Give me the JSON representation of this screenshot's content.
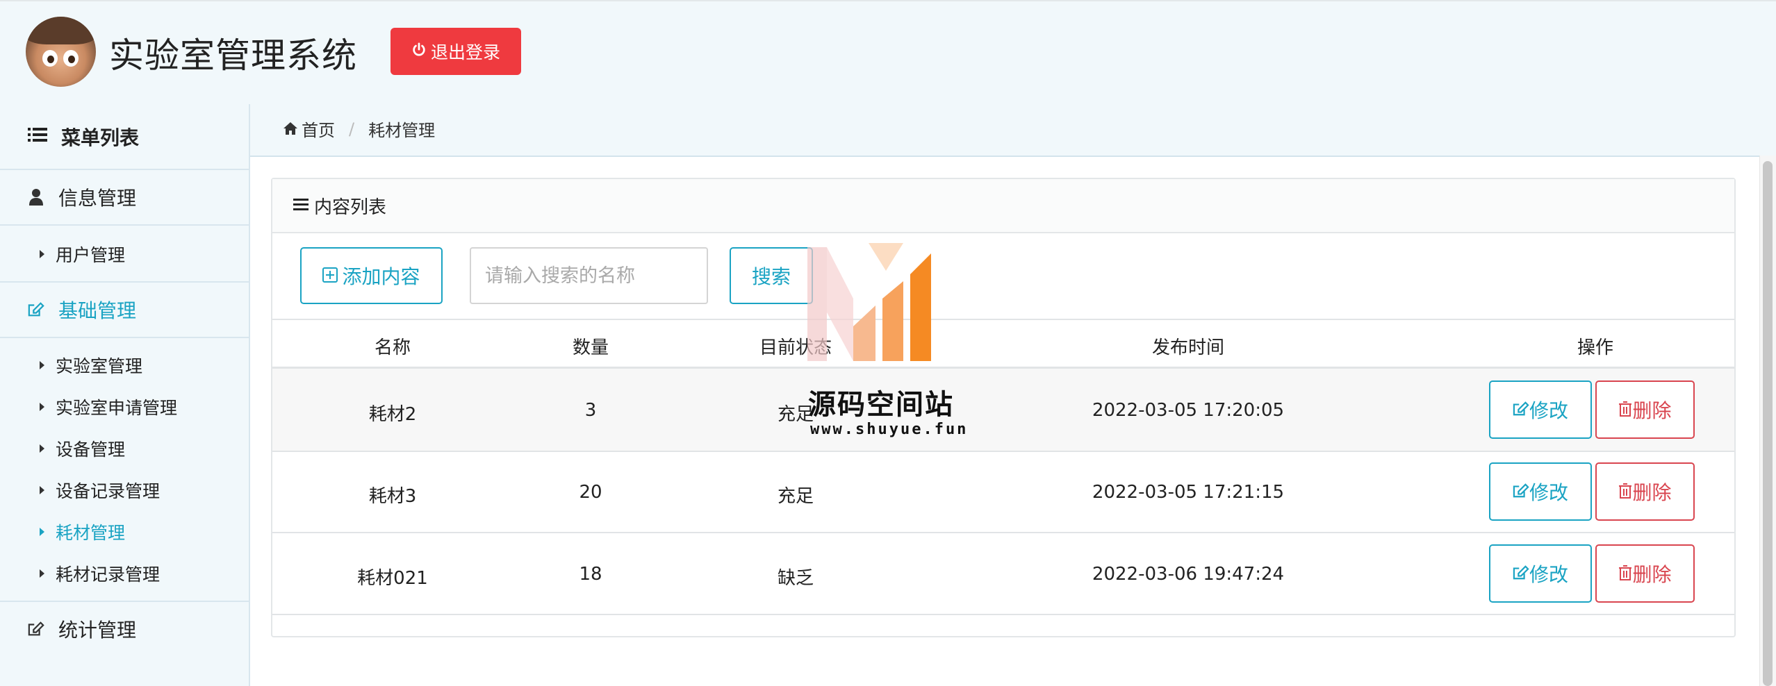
{
  "header": {
    "title": "实验室管理系统",
    "logout_label": "退出登录"
  },
  "sidebar": {
    "menu_title": "菜单列表",
    "groups": [
      {
        "label": "信息管理",
        "items": [
          {
            "label": "用户管理"
          }
        ]
      },
      {
        "label": "基础管理",
        "active": true,
        "items": [
          {
            "label": "实验室管理"
          },
          {
            "label": "实验室申请管理"
          },
          {
            "label": "设备管理"
          },
          {
            "label": "设备记录管理"
          },
          {
            "label": "耗材管理",
            "active": true
          },
          {
            "label": "耗材记录管理"
          }
        ]
      },
      {
        "label": "统计管理",
        "items": []
      }
    ]
  },
  "breadcrumb": {
    "home": "首页",
    "current": "耗材管理"
  },
  "card": {
    "title": "内容列表",
    "add_label": "添加内容",
    "search_placeholder": "请输入搜索的名称",
    "search_label": "搜索"
  },
  "table": {
    "columns": [
      "名称",
      "数量",
      "目前状态",
      "发布时间",
      "操作"
    ],
    "rows": [
      {
        "name": "耗材2",
        "qty": "3",
        "status": "充足",
        "time": "2022-03-05 17:20:05"
      },
      {
        "name": "耗材3",
        "qty": "20",
        "status": "充足",
        "time": "2022-03-05 17:21:15"
      },
      {
        "name": "耗材021",
        "qty": "18",
        "status": "缺乏",
        "time": "2022-03-06 19:47:24"
      }
    ],
    "edit_label": "修改",
    "delete_label": "删除"
  },
  "watermark": {
    "title": "源码空间站",
    "url": "www.shuyue.fun"
  },
  "colors": {
    "accent": "#1aa3c3",
    "danger": "#ef3a3f",
    "delete": "#d9454f"
  }
}
